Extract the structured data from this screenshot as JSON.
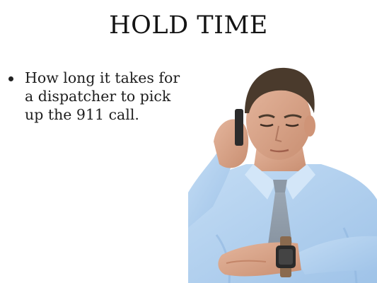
{
  "slide": {
    "title": "HOLD TIME",
    "bullets": [
      "How long it takes for a dispatcher to pick up the 911 call."
    ]
  },
  "photo": {
    "subject": "man-checking-wristwatch-on-phone",
    "colors": {
      "shirt": "#a9cdee",
      "tie": "#8e9aa8",
      "skin": "#d9a48a",
      "hair": "#4a3a2c"
    }
  }
}
